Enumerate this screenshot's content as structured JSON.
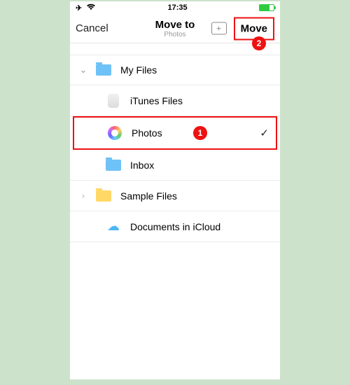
{
  "status": {
    "time": "17:35"
  },
  "nav": {
    "cancel": "Cancel",
    "title": "Move to",
    "subtitle": "Photos",
    "move": "Move"
  },
  "annotations": {
    "badge1": "1",
    "badge2": "2"
  },
  "list": {
    "myFiles": "My Files",
    "itunes": "iTunes Files",
    "photos": "Photos",
    "inbox": "Inbox",
    "sample": "Sample Files",
    "icloud": "Documents in iCloud"
  }
}
